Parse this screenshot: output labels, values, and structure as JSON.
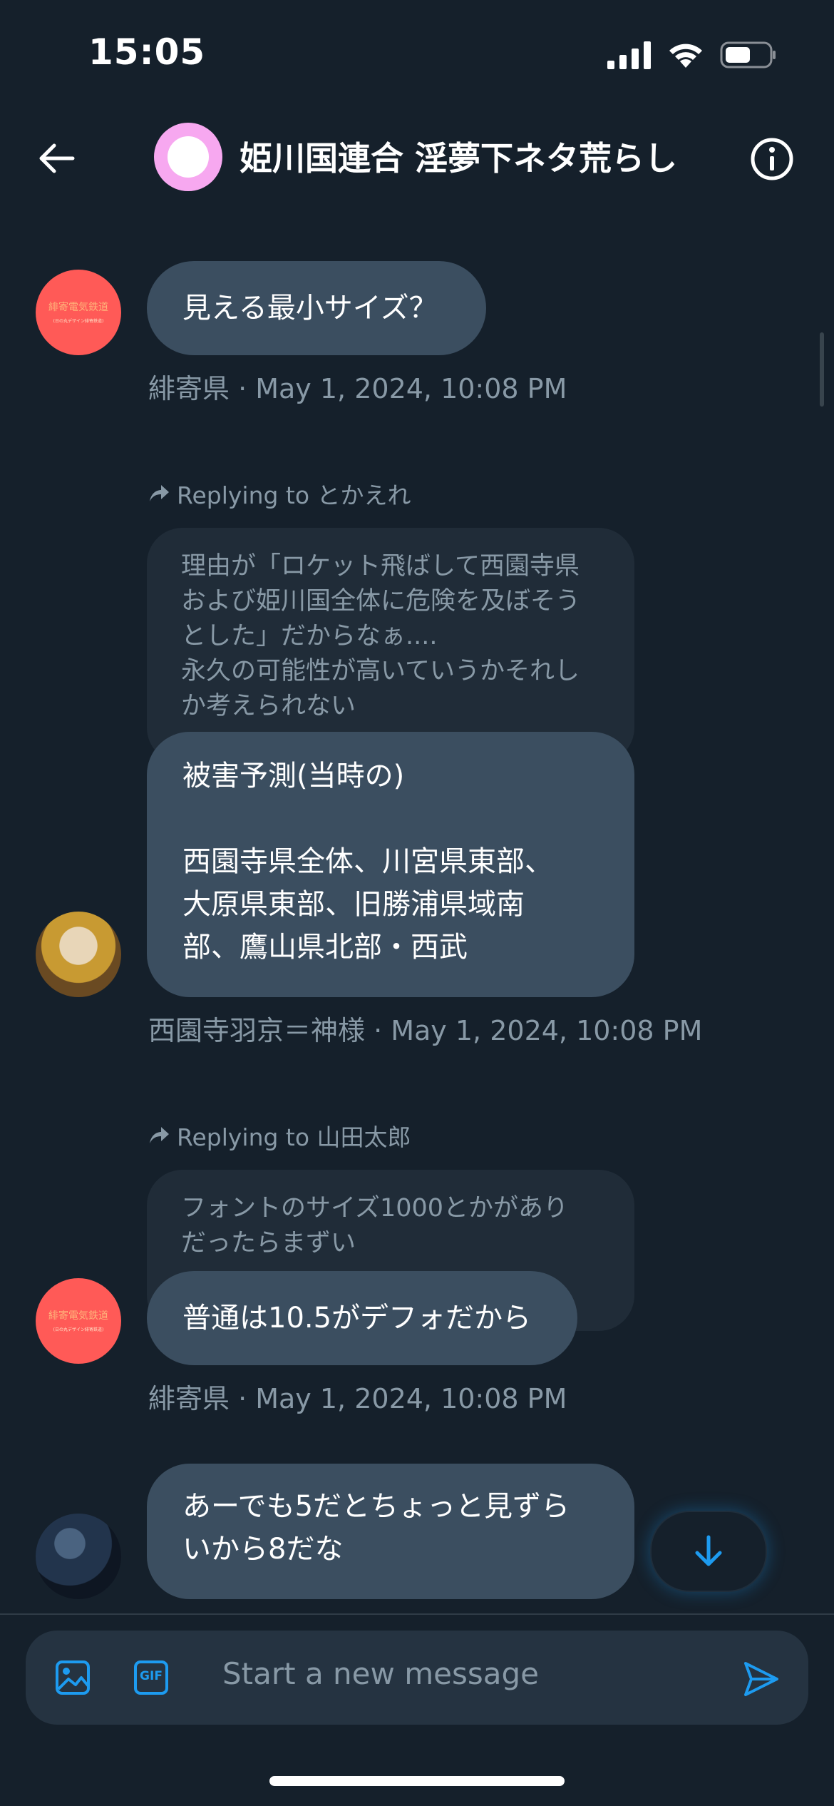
{
  "status_bar": {
    "time": "15:05"
  },
  "header": {
    "title": "姫川国連合 淫夢下ネタ荒らし"
  },
  "messages": [
    {
      "text": "見える最小サイズ？",
      "meta": "緋寄県 · May 1, 2024, 10:08 PM",
      "avatar_text_line1": "緋寄電気鉄道",
      "avatar_text_line2": "(日の丸デザイン緋寄鉄道)"
    },
    {
      "reply_to": "Replying to とかえれ",
      "quoted_text": "理由が「ロケット飛ばして西園寺県\nおよび姫川国全体に危険を及ぼそう\nとした」だからなぁ....\n永久の可能性が高いていうかそれし\nか考えられない",
      "text": "被害予測(当時の)\n\n西園寺県全体、川宮県東部、\n大原県東部、旧勝浦県域南\n部、鷹山県北部・西武",
      "meta": "西園寺羽京＝神様 · May 1, 2024, 10:08 PM"
    },
    {
      "reply_to": "Replying to 山田太郎",
      "quoted_text": "フォントのサイズ1000とかがあり\nだったらまずい",
      "text": "普通は10.5がデフォだから",
      "meta": "緋寄県 · May 1, 2024, 10:08 PM",
      "avatar_text_line1": "緋寄電気鉄道",
      "avatar_text_line2": "(日の丸デザイン緋寄鉄道)"
    },
    {
      "text": "あーでも5だとちょっと見ずら\nいから8だな"
    }
  ],
  "composer": {
    "placeholder": "Start a new message",
    "gif_label": "GIF"
  },
  "colors": {
    "accent": "#1d9bf0",
    "background": "#15202b",
    "bubble": "#3b4e60",
    "muted": "#8899a6"
  },
  "icons": [
    "back-arrow-icon",
    "info-icon",
    "reply-arrow-icon",
    "arrow-down-icon",
    "image-icon",
    "gif-icon",
    "send-icon",
    "signal-icon",
    "wifi-icon",
    "battery-icon"
  ]
}
